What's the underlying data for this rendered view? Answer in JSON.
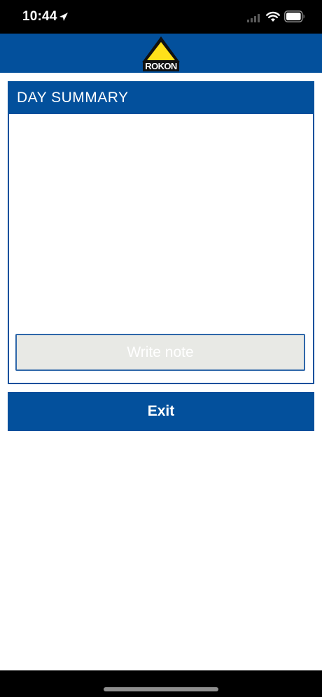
{
  "status_bar": {
    "time": "10:44"
  },
  "header": {
    "logo_text": "ROKON",
    "colors": {
      "brand_blue": "#03509c",
      "logo_yellow": "#ffe01a"
    }
  },
  "card": {
    "title": "DAY SUMMARY",
    "write_note_label": "Write note"
  },
  "actions": {
    "exit_label": "Exit"
  },
  "icons": {
    "location": "location-arrow-icon",
    "signal": "cellular-signal-icon",
    "wifi": "wifi-icon",
    "battery": "battery-icon"
  }
}
